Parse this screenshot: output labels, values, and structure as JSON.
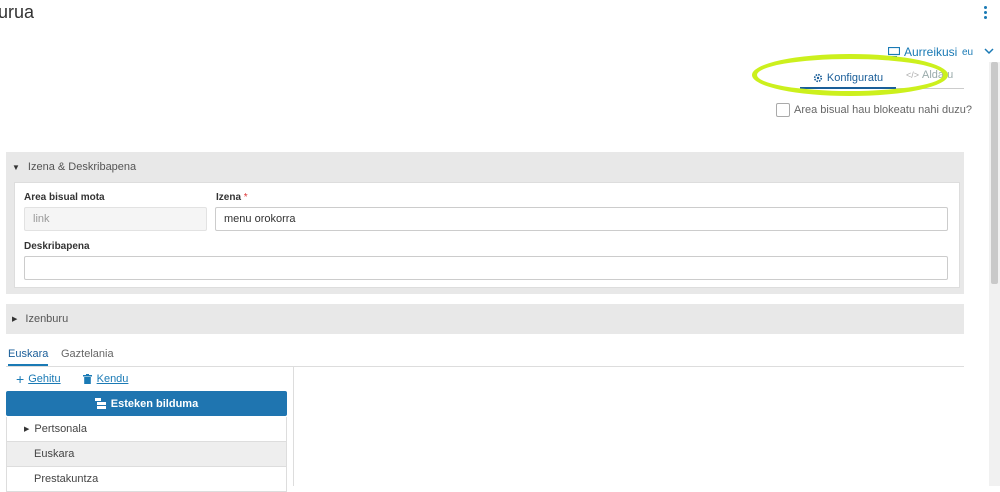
{
  "header": {
    "title": "urua"
  },
  "top_right": {
    "preview_label": "Aurreikusi",
    "language": "eu",
    "tabs": [
      {
        "label": "Konfiguratu",
        "icon": "gear-icon"
      },
      {
        "label": "Aldatu",
        "icon": "code-icon"
      }
    ],
    "lock_label": "Area bisual hau blokeatu nahi duzu?"
  },
  "section_name": {
    "title": "Izena & Deskribapena",
    "type_label": "Area bisual mota",
    "type_value": "link",
    "name_label": "Izena",
    "required_mark": "*",
    "name_value": "menu orokorra",
    "description_label": "Deskribapena",
    "description_value": ""
  },
  "section_header": {
    "title": "Izenburu"
  },
  "language_tabs": [
    "Euskara",
    "Gaztelania"
  ],
  "actions": {
    "add": "Gehitu",
    "remove": "Kendu"
  },
  "collection_button": "Esteken bilduma",
  "tree": [
    "Pertsonala",
    "Euskara",
    "Prestakuntza"
  ],
  "colors": {
    "accent": "#1f75b0",
    "highlight": "#ccf01d"
  }
}
